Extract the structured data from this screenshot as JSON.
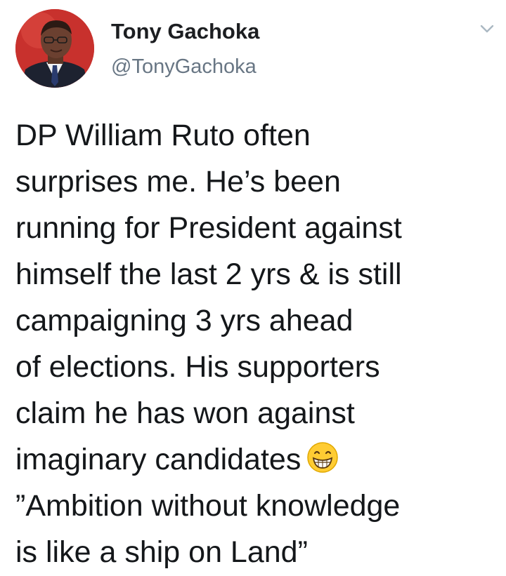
{
  "author": {
    "display_name": "Tony Gachoka",
    "handle": "@TonyGachoka"
  },
  "menu": {
    "icon": "chevron-down-icon"
  },
  "tweet": {
    "lines": [
      "DP William Ruto often",
      "surprises me. He’s been",
      "running for President against",
      "himself the last 2 yrs & is still",
      "campaigning 3 yrs ahead",
      "of elections. His supporters",
      "claim he has won against",
      "imaginary candidates",
      "”Ambition without knowledge",
      "is like a ship on Land”"
    ],
    "emoji": "grinning-face-icon"
  },
  "colors": {
    "avatar_background": "#c8312d",
    "handle_gray": "#687684",
    "text": "#14171a"
  }
}
